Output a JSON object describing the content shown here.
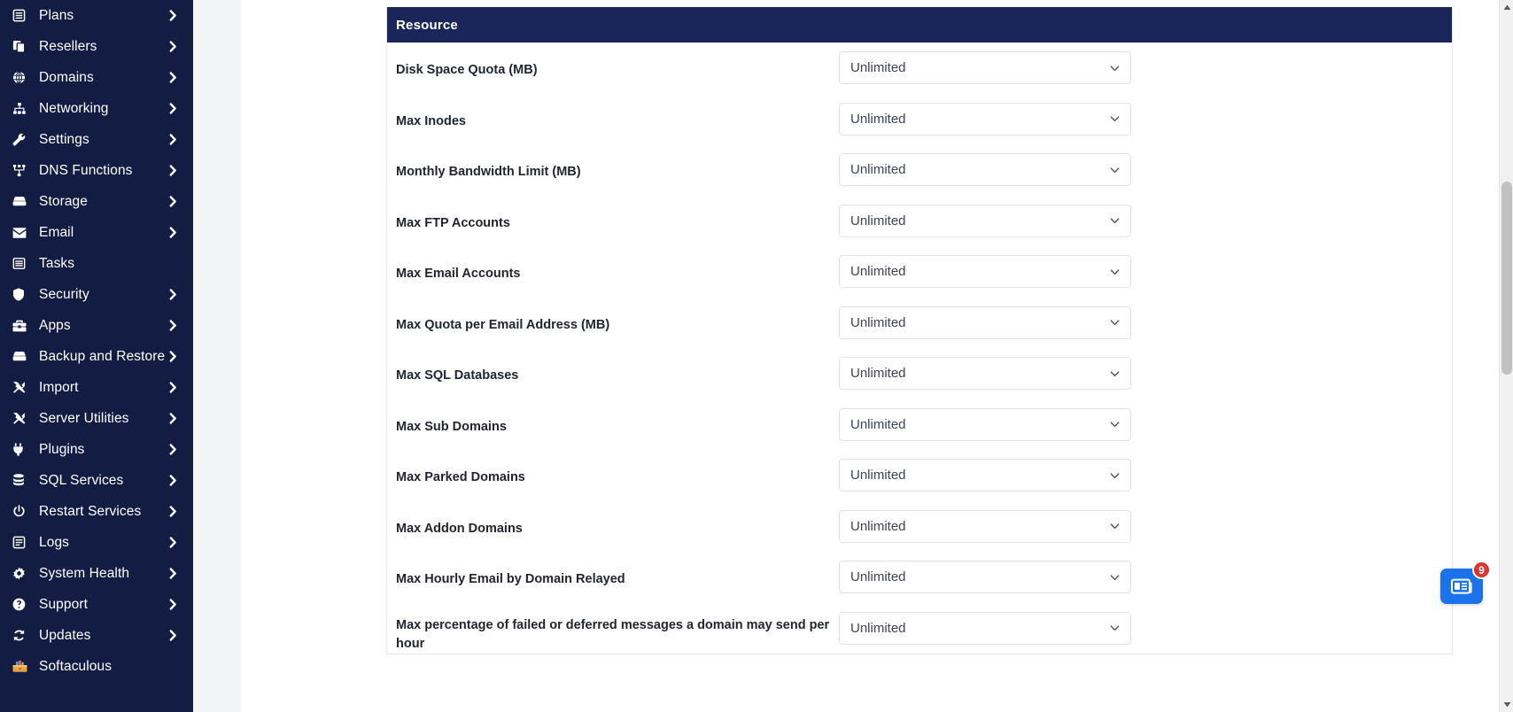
{
  "sidebar": {
    "items": [
      {
        "label": "Plans",
        "icon": "server-icon",
        "has_chevron": true
      },
      {
        "label": "Resellers",
        "icon": "copy-icon",
        "has_chevron": true
      },
      {
        "label": "Domains",
        "icon": "globe-icon",
        "has_chevron": true
      },
      {
        "label": "Networking",
        "icon": "sitemap-icon",
        "has_chevron": true
      },
      {
        "label": "Settings",
        "icon": "wrench-icon",
        "has_chevron": true
      },
      {
        "label": "DNS Functions",
        "icon": "network-node-icon",
        "has_chevron": true
      },
      {
        "label": "Storage",
        "icon": "hdd-icon",
        "has_chevron": true
      },
      {
        "label": "Email",
        "icon": "envelope-icon",
        "has_chevron": true
      },
      {
        "label": "Tasks",
        "icon": "list-icon",
        "has_chevron": false
      },
      {
        "label": "Security",
        "icon": "shield-icon",
        "has_chevron": true
      },
      {
        "label": "Apps",
        "icon": "toolbox-icon",
        "has_chevron": true
      },
      {
        "label": "Backup and Restore",
        "icon": "hdd-icon",
        "has_chevron": true
      },
      {
        "label": "Import",
        "icon": "tools-icon",
        "has_chevron": true
      },
      {
        "label": "Server Utilities",
        "icon": "tools-icon",
        "has_chevron": true
      },
      {
        "label": "Plugins",
        "icon": "plug-icon",
        "has_chevron": true
      },
      {
        "label": "SQL Services",
        "icon": "database-icon",
        "has_chevron": true
      },
      {
        "label": "Restart Services",
        "icon": "power-icon",
        "has_chevron": true
      },
      {
        "label": "Logs",
        "icon": "log-icon",
        "has_chevron": true
      },
      {
        "label": "System Health",
        "icon": "gear-icon",
        "has_chevron": true
      },
      {
        "label": "Support",
        "icon": "question-circle-icon",
        "has_chevron": true
      },
      {
        "label": "Updates",
        "icon": "refresh-icon",
        "has_chevron": true
      },
      {
        "label": "Softaculous",
        "icon": "softaculous-icon",
        "has_chevron": false
      }
    ]
  },
  "panel": {
    "title": "Resource",
    "rows": [
      {
        "label": "Disk Space Quota (MB)",
        "value": "Unlimited"
      },
      {
        "label": "Max Inodes",
        "value": "Unlimited"
      },
      {
        "label": "Monthly Bandwidth Limit (MB)",
        "value": "Unlimited"
      },
      {
        "label": "Max FTP Accounts",
        "value": "Unlimited"
      },
      {
        "label": "Max Email Accounts",
        "value": "Unlimited"
      },
      {
        "label": "Max Quota per Email Address (MB)",
        "value": "Unlimited"
      },
      {
        "label": "Max SQL Databases",
        "value": "Unlimited"
      },
      {
        "label": "Max Sub Domains",
        "value": "Unlimited"
      },
      {
        "label": "Max Parked Domains",
        "value": "Unlimited"
      },
      {
        "label": "Max Addon Domains",
        "value": "Unlimited"
      },
      {
        "label": "Max Hourly Email by Domain Relayed",
        "value": "Unlimited"
      },
      {
        "label": "Max percentage of failed or deferred messages a domain may send per hour",
        "value": "Unlimited"
      }
    ]
  },
  "chat_widget": {
    "badge_count": "9",
    "icon": "news-icon"
  },
  "colors": {
    "sidebar_bg": "#131C43",
    "panel_header_bg": "#1B2559",
    "chat_blue": "#1a73e8",
    "badge_red": "#e1342c"
  }
}
